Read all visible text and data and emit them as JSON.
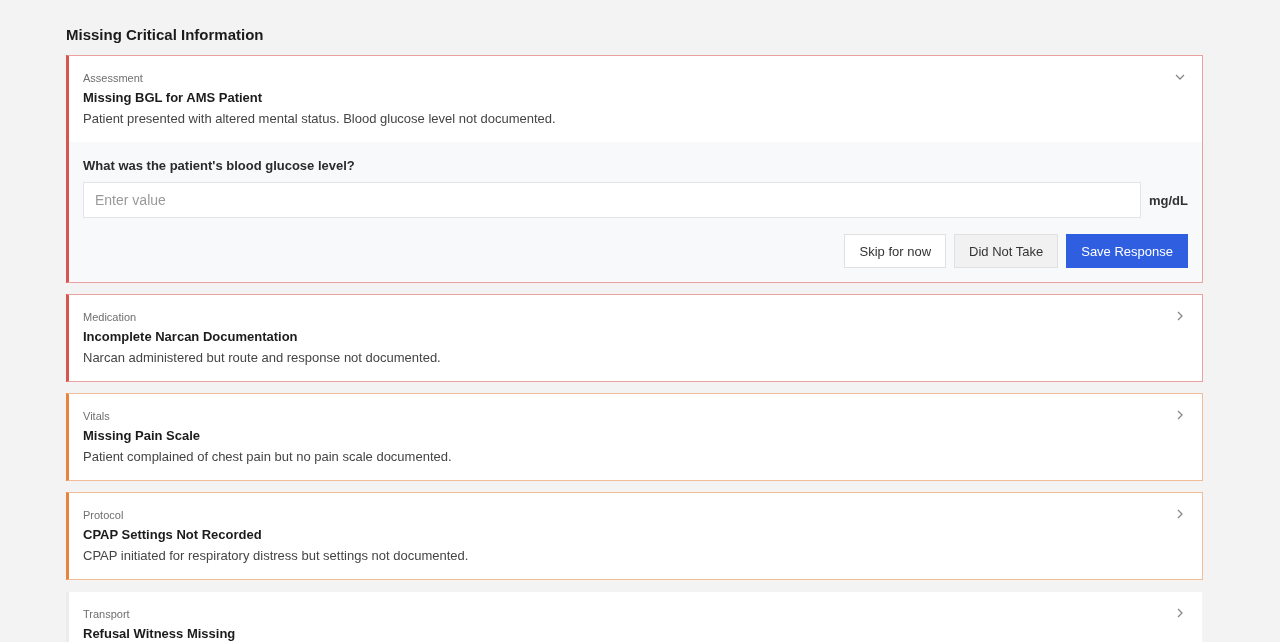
{
  "heading": "Missing Critical Information",
  "items": [
    {
      "category": "Assessment",
      "title": "Missing BGL for AMS Patient",
      "description": "Patient presented with altered mental status. Blood glucose level not documented.",
      "color": "#d9534f",
      "expanded": true,
      "form": {
        "question": "What was the patient's blood glucose level?",
        "placeholder": "Enter value",
        "unit": "mg/dL",
        "buttons": [
          {
            "label": "Skip for now",
            "kind": "outline"
          },
          {
            "label": "Did Not Take",
            "kind": "muted"
          },
          {
            "label": "Save Response",
            "kind": "primary"
          }
        ]
      }
    },
    {
      "category": "Medication",
      "title": "Incomplete Narcan Documentation",
      "description": "Narcan administered but route and response not documented.",
      "color": "#d9534f",
      "expanded": false
    },
    {
      "category": "Vitals",
      "title": "Missing Pain Scale",
      "description": "Patient complained of chest pain but no pain scale documented.",
      "color": "#e8843c",
      "expanded": false
    },
    {
      "category": "Protocol",
      "title": "CPAP Settings Not Recorded",
      "description": "CPAP initiated for respiratory distress but settings not documented.",
      "color": "#e8843c",
      "expanded": false
    },
    {
      "category": "Transport",
      "title": "Refusal Witness Missing",
      "color": "#ececec",
      "expanded": false
    }
  ]
}
